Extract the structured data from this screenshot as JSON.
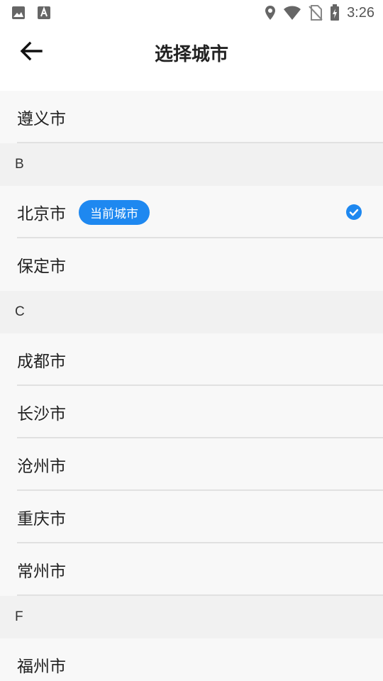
{
  "status_bar": {
    "time": "3:26",
    "left_icons": [
      "image-icon",
      "text-a-icon"
    ],
    "right_icons": [
      "location-icon",
      "wifi-icon",
      "no-sim-icon",
      "battery-charging-icon"
    ]
  },
  "header": {
    "title": "选择城市",
    "back_icon": "arrow-left-icon"
  },
  "list": {
    "top_item": "遵义市",
    "sections": [
      {
        "letter": "B",
        "items": [
          {
            "name": "北京市",
            "badge": "当前城市",
            "selected": true
          },
          {
            "name": "保定市"
          }
        ]
      },
      {
        "letter": "C",
        "items": [
          {
            "name": "成都市"
          },
          {
            "name": "长沙市"
          },
          {
            "name": "沧州市"
          },
          {
            "name": "重庆市"
          },
          {
            "name": "常州市"
          }
        ]
      },
      {
        "letter": "F",
        "items": [
          {
            "name": "福州市"
          }
        ]
      }
    ]
  },
  "colors": {
    "accent": "#1e88f0",
    "row_bg": "#f8f8f8",
    "section_bg": "#f1f1f1",
    "divider": "#e1e1e1"
  }
}
